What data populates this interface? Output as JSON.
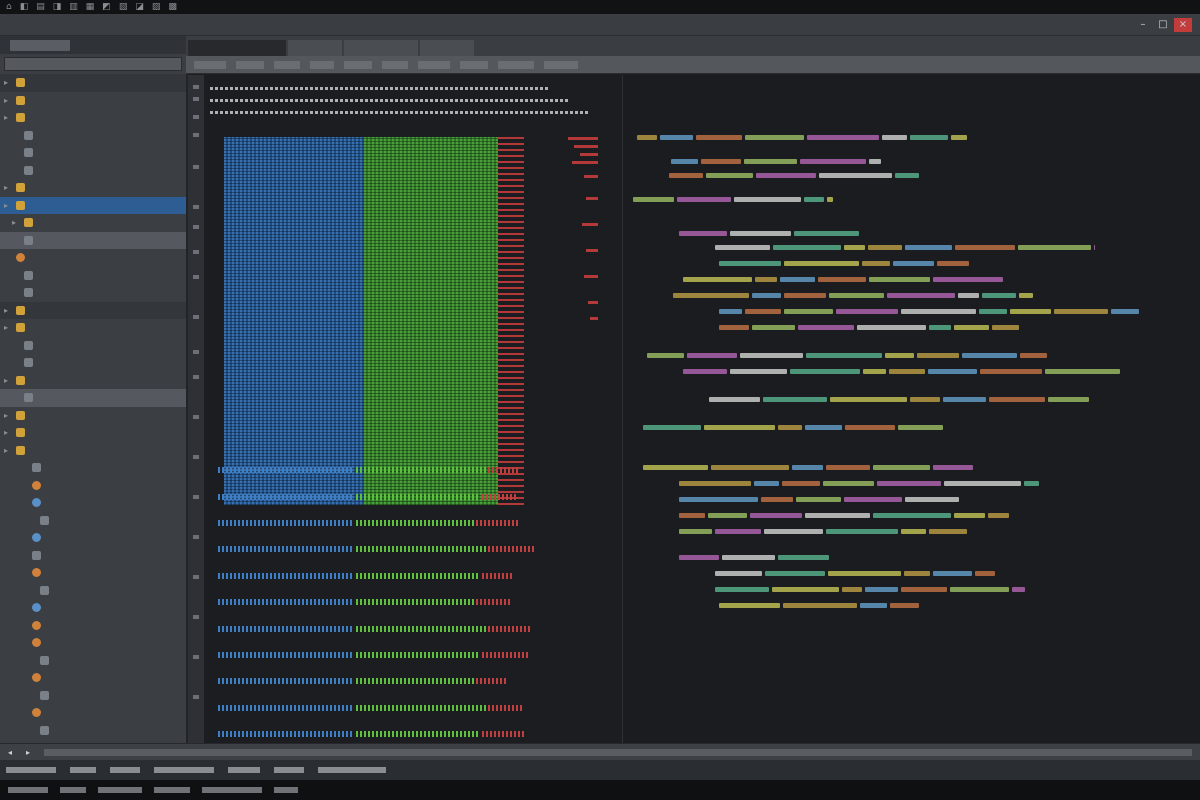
{
  "topbar": {
    "glyphs": [
      "⌂",
      "◧",
      "▤",
      "◨",
      "▥",
      "▦",
      "◩",
      "▧",
      "◪",
      "▨",
      "▩"
    ]
  },
  "window": {
    "title": ""
  },
  "sidebar": {
    "title": "",
    "tree": [
      {
        "icon": "folder",
        "state": "section"
      },
      {
        "icon": "folder"
      },
      {
        "icon": "folder"
      },
      {
        "icon": "file"
      },
      {
        "icon": "file"
      },
      {
        "icon": "file"
      },
      {
        "icon": "folder"
      },
      {
        "icon": "folder",
        "state": "selected"
      },
      {
        "icon": "folder"
      },
      {
        "icon": "file",
        "state": "hl"
      },
      {
        "icon": "orange"
      },
      {
        "icon": "file"
      },
      {
        "icon": "file"
      },
      {
        "icon": "folder",
        "state": "section"
      },
      {
        "icon": "folder"
      },
      {
        "icon": "file"
      },
      {
        "icon": "file"
      },
      {
        "icon": "folder"
      },
      {
        "icon": "file",
        "state": "hl"
      },
      {
        "icon": "folder"
      },
      {
        "icon": "folder"
      },
      {
        "icon": "folder"
      },
      {
        "icon": "file"
      },
      {
        "icon": "orange"
      },
      {
        "icon": "blue"
      },
      {
        "icon": "file"
      },
      {
        "icon": "blue"
      },
      {
        "icon": "file"
      },
      {
        "icon": "orange"
      },
      {
        "icon": "file"
      },
      {
        "icon": "blue"
      },
      {
        "icon": "orange"
      },
      {
        "icon": "orange"
      },
      {
        "icon": "file"
      },
      {
        "icon": "orange"
      },
      {
        "icon": "file"
      },
      {
        "icon": "orange"
      },
      {
        "icon": "file"
      },
      {
        "icon": "orange"
      },
      {
        "icon": "file"
      }
    ]
  },
  "editor": {
    "tabs": [
      {
        "label": "",
        "active": true
      },
      {
        "label": ""
      },
      {
        "label": ""
      },
      {
        "label": ""
      }
    ],
    "toolbar": [
      "",
      "",
      "",
      "",
      "",
      "",
      "",
      "",
      "",
      ""
    ]
  },
  "icons": {
    "minimize": "minimize-icon",
    "maximize": "maximize-icon",
    "close": "close-icon",
    "folder": "folder-icon",
    "file": "file-icon"
  },
  "colors": {
    "selection": "#2e5d93",
    "series_blue": "#1f4f87",
    "series_green": "#2e7a28",
    "series_red": "#b33838"
  },
  "panel_tabs": [
    "",
    "",
    "",
    "",
    "",
    "",
    ""
  ],
  "taskbar": {
    "items": [
      "",
      "",
      "",
      "",
      "",
      ""
    ]
  }
}
